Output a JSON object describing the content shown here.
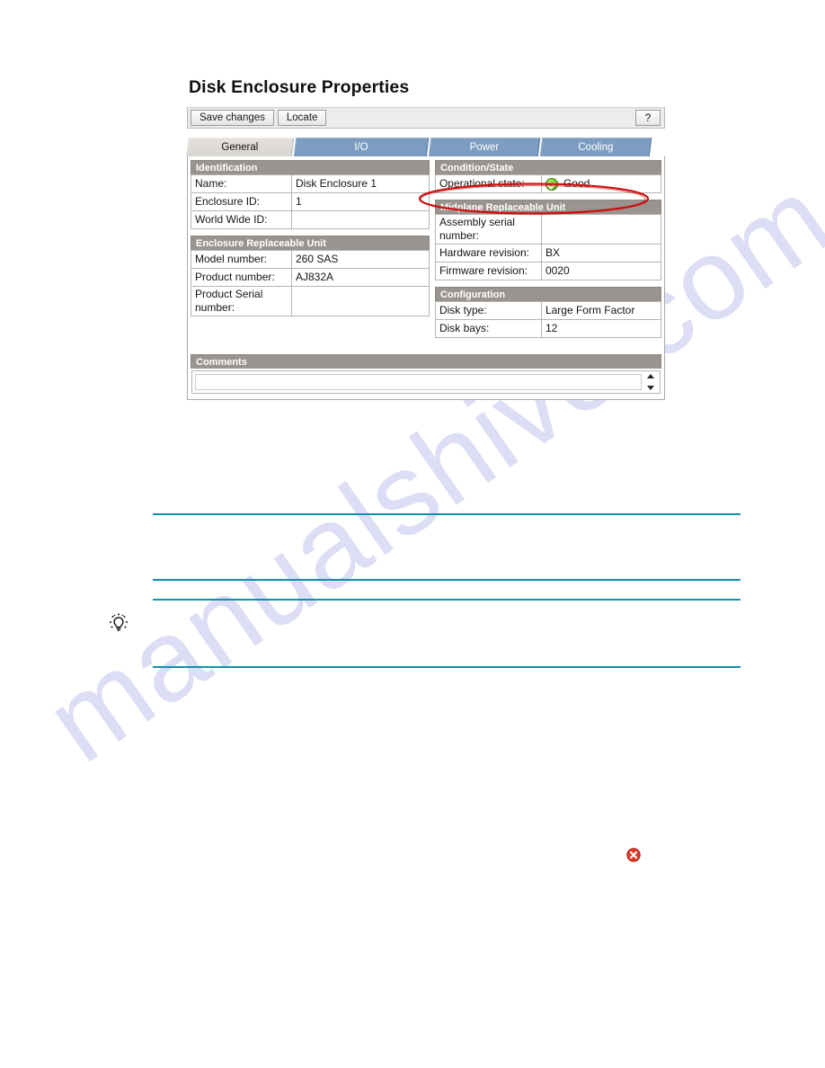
{
  "document": {
    "watermark": "manualshive.com"
  },
  "app": {
    "title": "Disk Enclosure Properties",
    "toolbar": {
      "save_label": "Save changes",
      "locate_label": "Locate",
      "help_label": "?"
    },
    "tabs": [
      {
        "label": "General",
        "active": true
      },
      {
        "label": "I/O",
        "active": false
      },
      {
        "label": "Power",
        "active": false
      },
      {
        "label": "Cooling",
        "active": false
      }
    ],
    "sections": {
      "identification": {
        "heading": "Identification",
        "rows": [
          {
            "label": "Name:",
            "value": "Disk Enclosure 1"
          },
          {
            "label": "Enclosure ID:",
            "value": "1"
          },
          {
            "label": "World Wide ID:",
            "value": ""
          }
        ]
      },
      "enclosure_replaceable_unit": {
        "heading": "Enclosure Replaceable Unit",
        "rows": [
          {
            "label": "Model number:",
            "value": "260 SAS"
          },
          {
            "label": "Product number:",
            "value": "AJ832A"
          },
          {
            "label": "Product Serial number:",
            "value": ""
          }
        ]
      },
      "condition_state": {
        "heading": "Condition/State",
        "rows": [
          {
            "label": "Operational state:",
            "value": "Good",
            "icon": "status-good-icon"
          }
        ]
      },
      "midplane_replaceable_unit": {
        "heading": "Midplane Replaceable Unit",
        "rows": [
          {
            "label": "Assembly serial number:",
            "value": ""
          },
          {
            "label": "Hardware revision:",
            "value": "BX"
          },
          {
            "label": "Firmware revision:",
            "value": "0020"
          }
        ]
      },
      "configuration": {
        "heading": "Configuration",
        "rows": [
          {
            "label": "Disk type:",
            "value": "Large Form Factor"
          },
          {
            "label": "Disk bays:",
            "value": "12"
          }
        ]
      },
      "comments": {
        "heading": "Comments",
        "value": "",
        "placeholder": ""
      }
    },
    "annotation": {
      "shape": "ellipse",
      "color": "#cc1111",
      "target": "Operational state: Good"
    }
  },
  "page_icons": {
    "tip_icon": "lightbulb-tip-icon",
    "error_icon": "status-error-icon"
  },
  "colors": {
    "accent_tab": "#7c9dc0",
    "section_header": "#9a9490",
    "rule_line": "#1091ad",
    "annotation_red": "#cc1111",
    "status_good_green": "#6fc82a",
    "status_error_red": "#e03b24",
    "watermark": "#c9c9ef"
  }
}
